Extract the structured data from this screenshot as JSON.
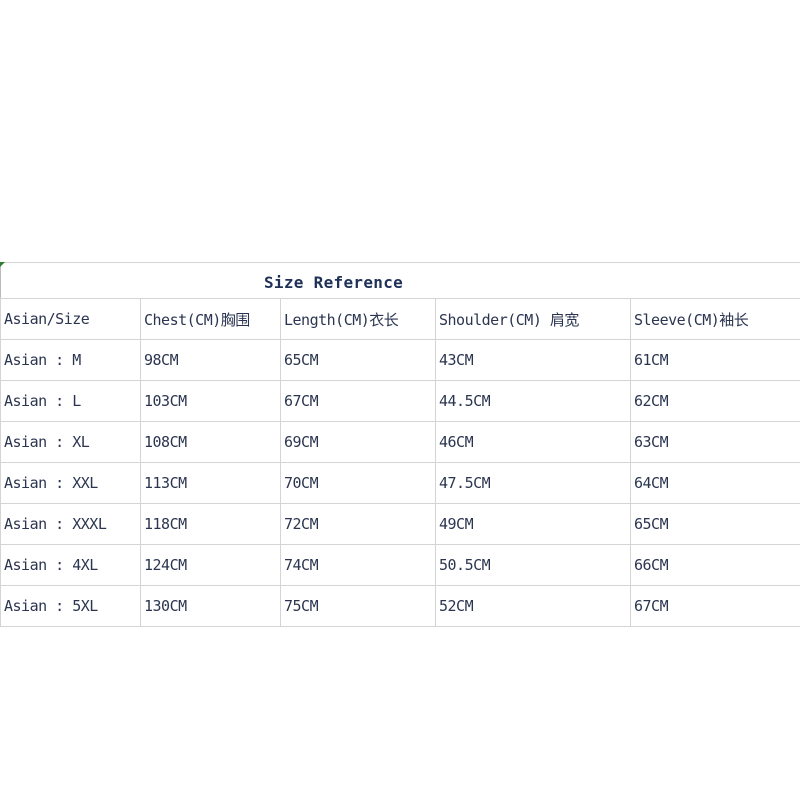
{
  "title": "Size Reference",
  "headers": [
    "Asian/Size",
    "Chest(CM)胸围",
    "Length(CM)衣长",
    "Shoulder(CM) 肩宽",
    "Sleeve(CM)袖长"
  ],
  "rows": [
    [
      "Asian : M",
      "98CM",
      "65CM",
      "43CM",
      "61CM"
    ],
    [
      "Asian : L",
      "103CM",
      "67CM",
      "44.5CM",
      "62CM"
    ],
    [
      "Asian : XL",
      "108CM",
      "69CM",
      "46CM",
      "63CM"
    ],
    [
      "Asian : XXL",
      "113CM",
      "70CM",
      "47.5CM",
      "64CM"
    ],
    [
      "Asian : XXXL",
      "118CM",
      "72CM",
      "49CM",
      "65CM"
    ],
    [
      "Asian : 4XL",
      "124CM",
      "74CM",
      "50.5CM",
      "66CM"
    ],
    [
      "Asian : 5XL",
      "130CM",
      "75CM",
      "52CM",
      "67CM"
    ]
  ]
}
